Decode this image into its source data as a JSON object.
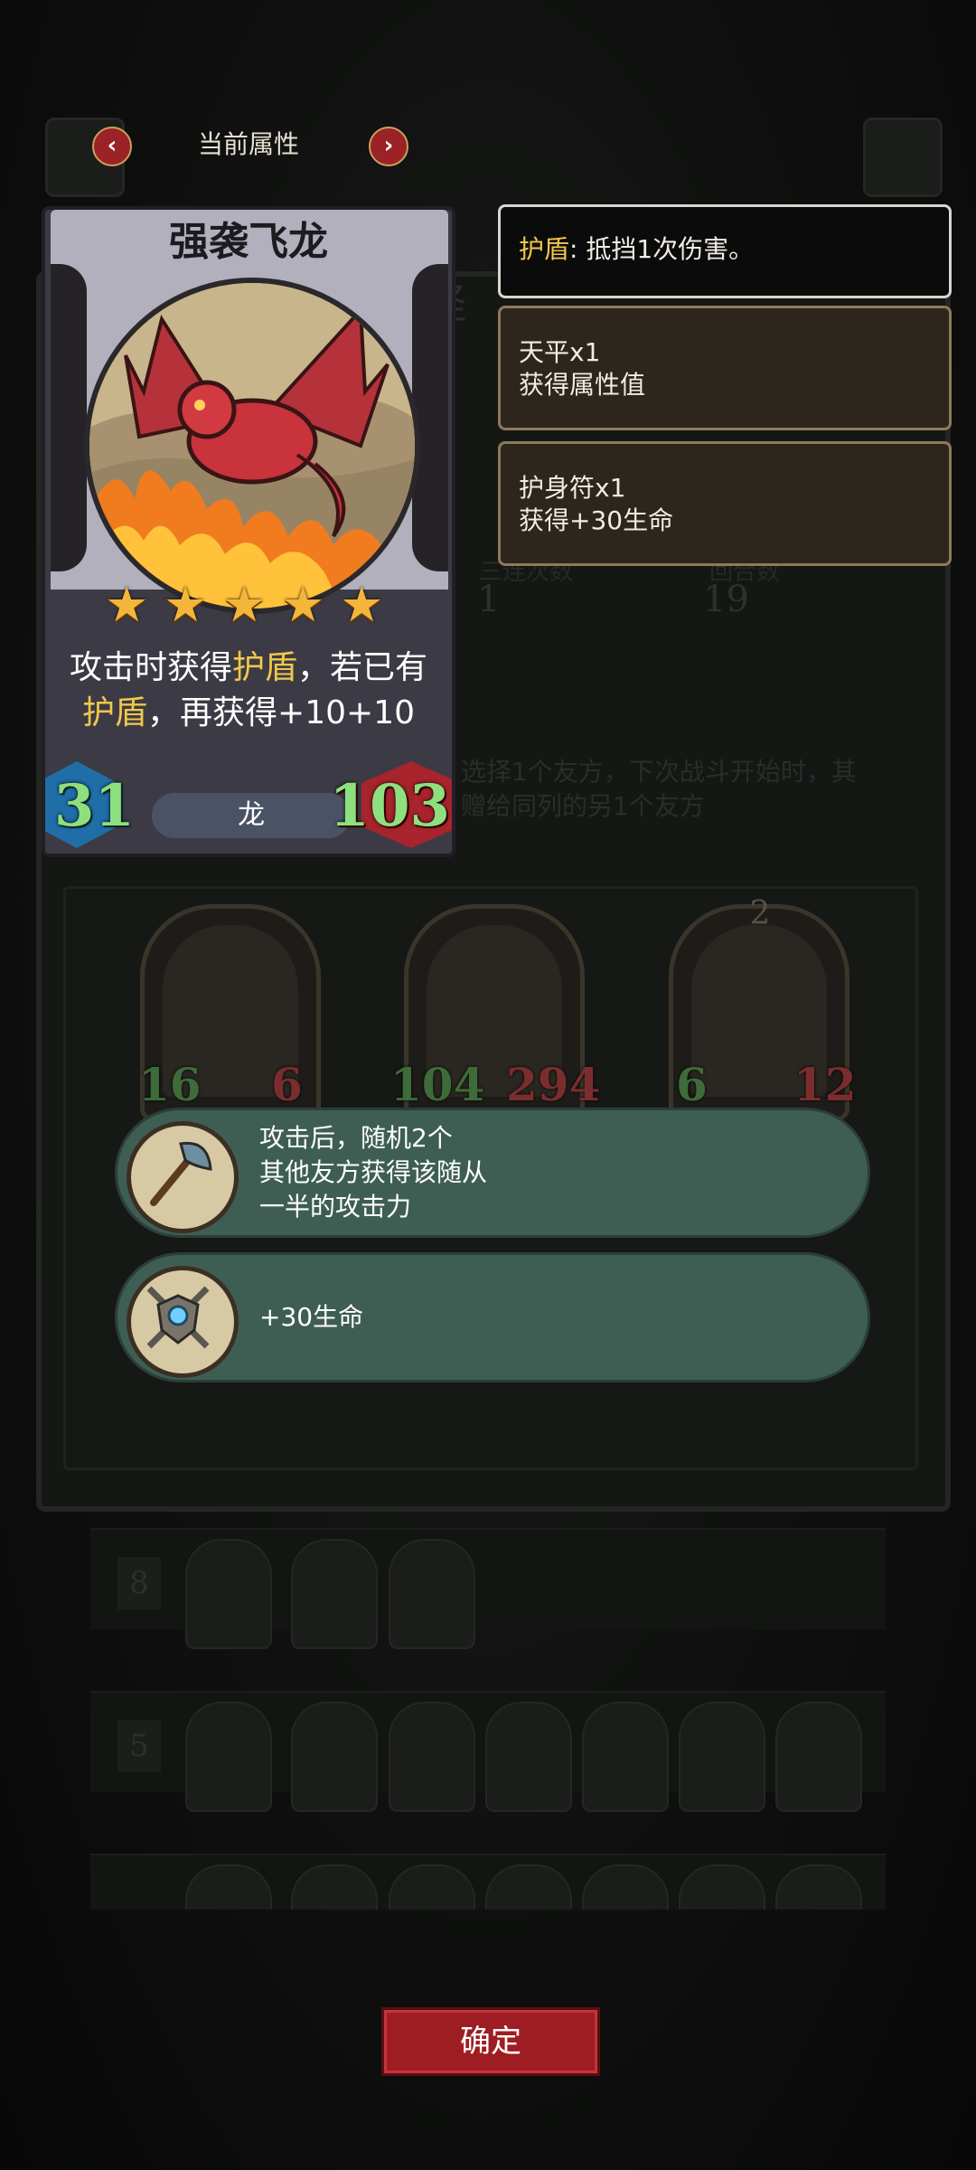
{
  "header": {
    "title": "当前属性",
    "prev_icon": "chevron-left-icon",
    "next_icon": "chevron-right-icon"
  },
  "card": {
    "name": "强袭飞龙",
    "stars": 5,
    "ability_parts": [
      "攻击时获得",
      "护盾",
      "，若已有",
      "护盾",
      "，再获得+10+10"
    ],
    "attack": "31",
    "health": "103",
    "tribe": "龙"
  },
  "tooltips": {
    "shield_keyword": "护盾",
    "shield_desc": ": 抵挡1次伤害。",
    "items": [
      {
        "name": "天平x1",
        "desc": "获得属性值"
      },
      {
        "name": "护身符x1",
        "desc": "获得+30生命"
      }
    ]
  },
  "effects": [
    {
      "icon": "axe-icon",
      "text_lines": [
        "攻击后，随机2个",
        "其他友方获得该随从",
        "一半的攻击力"
      ]
    },
    {
      "icon": "shield-amulet-icon",
      "text_lines": [
        "+30生命"
      ]
    }
  ],
  "background": {
    "title_fragment": "怪",
    "stat_labels": [
      "三连次数",
      "回合数"
    ],
    "stat_values": [
      "1",
      "19"
    ],
    "desc": "选择1个友方，下次战斗开始时，其\n赠给同列的另1个友方",
    "units": [
      {
        "attack": "16",
        "health": "6"
      },
      {
        "attack": "104",
        "health": "294"
      },
      {
        "attack": "6",
        "health": "12",
        "tier": "2"
      }
    ],
    "shop_tiers": [
      "8",
      "5"
    ]
  },
  "confirm_label": "确定",
  "colors": {
    "accent_red": "#9e1d22",
    "keyword_gold": "#f2c84b",
    "stat_green": "#8ee07e",
    "bubble_green": "#3f5e53"
  }
}
